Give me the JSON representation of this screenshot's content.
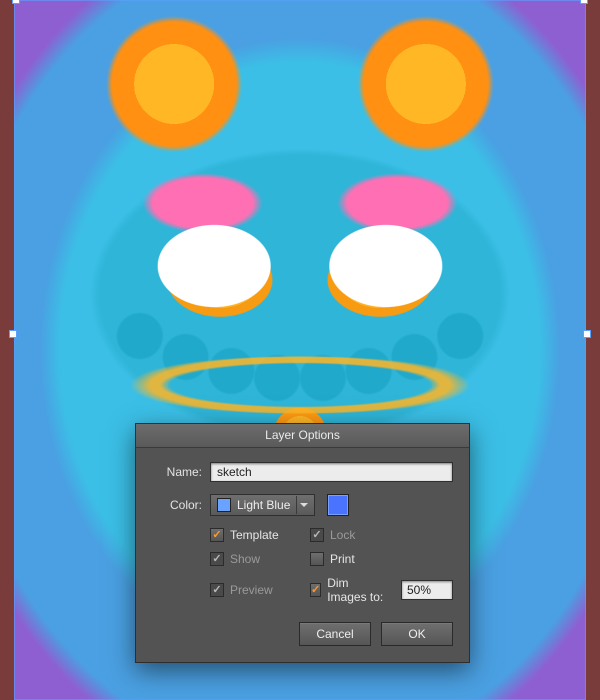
{
  "dialog": {
    "title": "Layer Options",
    "name_label": "Name:",
    "name_value": "sketch",
    "color_label": "Color:",
    "color_select": "Light Blue",
    "color_swatch": "#4a74ff",
    "checks": {
      "template": "Template",
      "lock": "Lock",
      "show": "Show",
      "print": "Print",
      "preview": "Preview",
      "dim": "Dim Images to:",
      "dim_value": "50%"
    },
    "buttons": {
      "cancel": "Cancel",
      "ok": "OK"
    }
  }
}
